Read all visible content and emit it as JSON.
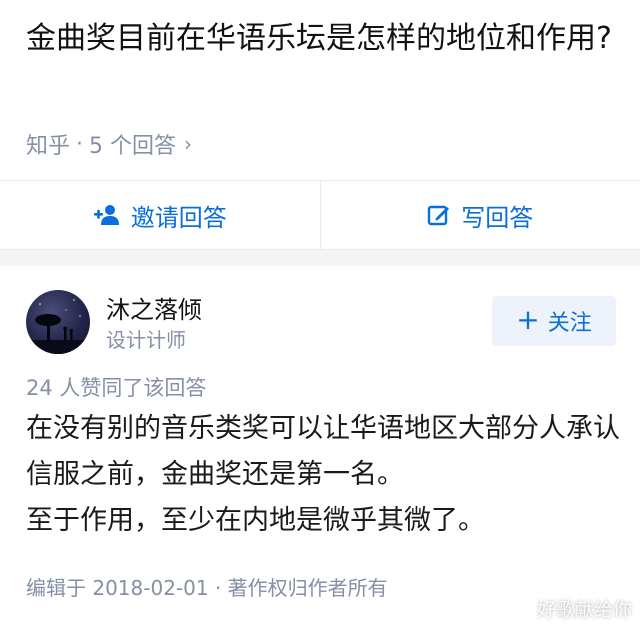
{
  "question": {
    "title": "金曲奖目前在华语乐坛是怎样的地位和作用?",
    "source": "知乎",
    "separator": "·",
    "answer_count": "5 个回答",
    "chevron": "›"
  },
  "actions": {
    "invite_label": "邀请回答",
    "write_label": "写回答"
  },
  "author": {
    "name": "沐之落倾",
    "bio": "设计计师",
    "follow_label": "关注"
  },
  "answer": {
    "votes": "24 人赞同了该回答",
    "paragraphs": [
      "在没有别的音乐类奖可以让华语地区大部分人承认信服之前，金曲奖还是第一名。",
      "至于作用，至少在内地是微乎其微了。"
    ],
    "footer": "编辑于 2018-02-01 · 著作权归作者所有"
  },
  "watermark": "好歌献给你",
  "colors": {
    "accent": "#0a6fdb",
    "muted": "#8590a6",
    "follow_bg": "#eef3fb"
  },
  "icons": {
    "invite": "add-person-icon",
    "write": "edit-icon",
    "follow": "plus-icon"
  }
}
